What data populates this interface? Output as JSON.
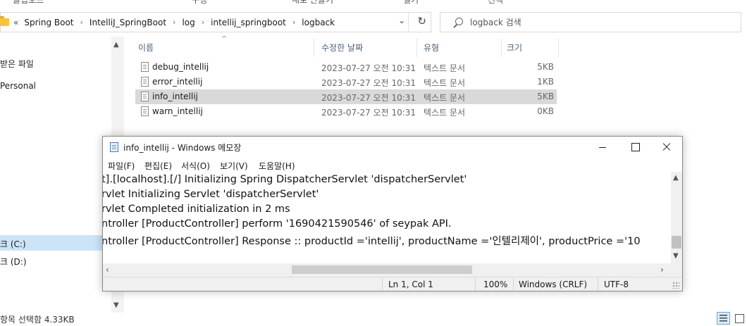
{
  "ribbon": {
    "tabs": [
      "클립보드",
      "구성",
      "새로 만들기",
      "열기",
      "선택"
    ]
  },
  "address": {
    "overflow_chevron": "«",
    "breadcrumbs": [
      "Spring Boot",
      "IntelliJ_SpringBoot",
      "log",
      "intellij_springboot",
      "logback"
    ],
    "separator": "›",
    "dropdown": "⌄",
    "refresh": "↻"
  },
  "search": {
    "placeholder": "logback 검색"
  },
  "nav": {
    "items": [
      "받은 파일",
      "Personal",
      "크 (C:)",
      "크 (D:)"
    ],
    "scroll_up": "▲",
    "scroll_down": "▼"
  },
  "columns": {
    "name": "이름",
    "date": "수정한 날짜",
    "type": "유형",
    "size": "크기",
    "sort_caret": "^"
  },
  "files": [
    {
      "name": "debug_intellij",
      "date": "2023-07-27 오전 10:31",
      "type": "텍스트 문서",
      "size": "5KB"
    },
    {
      "name": "error_intellij",
      "date": "2023-07-27 오전 10:31",
      "type": "텍스트 문서",
      "size": "1KB"
    },
    {
      "name": "info_intellij",
      "date": "2023-07-27 오전 10:31",
      "type": "텍스트 문서",
      "size": "5KB"
    },
    {
      "name": "warn_intellij",
      "date": "2023-07-27 오전 10:31",
      "type": "텍스트 문서",
      "size": "0KB"
    }
  ],
  "status": {
    "text": "항목 선택함 4.33KB"
  },
  "notepad": {
    "title": "info_intellij - Windows 메모장",
    "menus": [
      "파일(F)",
      "편집(E)",
      "서식(O)",
      "보기(V)",
      "도움말(H)"
    ],
    "lines": [
      "t].[localhost].[/] Initializing Spring DispatcherServlet 'dispatcherServlet'",
      "rvlet Initializing Servlet 'dispatcherServlet'",
      "rvlet Completed initialization in 2 ms",
      "ntroller [ProductController] perform '1690421590546' of seypak API.",
      "ntroller [ProductController] Response :: productId ='intellij', productName ='인텔리제이', productPrice ='10"
    ],
    "status": {
      "position": "Ln 1, Col 1",
      "zoom": "100%",
      "line_ending": "Windows (CRLF)",
      "encoding": "UTF-8"
    },
    "scroll": {
      "up": "▲",
      "down": "▼",
      "left": "‹",
      "right": "›"
    }
  }
}
